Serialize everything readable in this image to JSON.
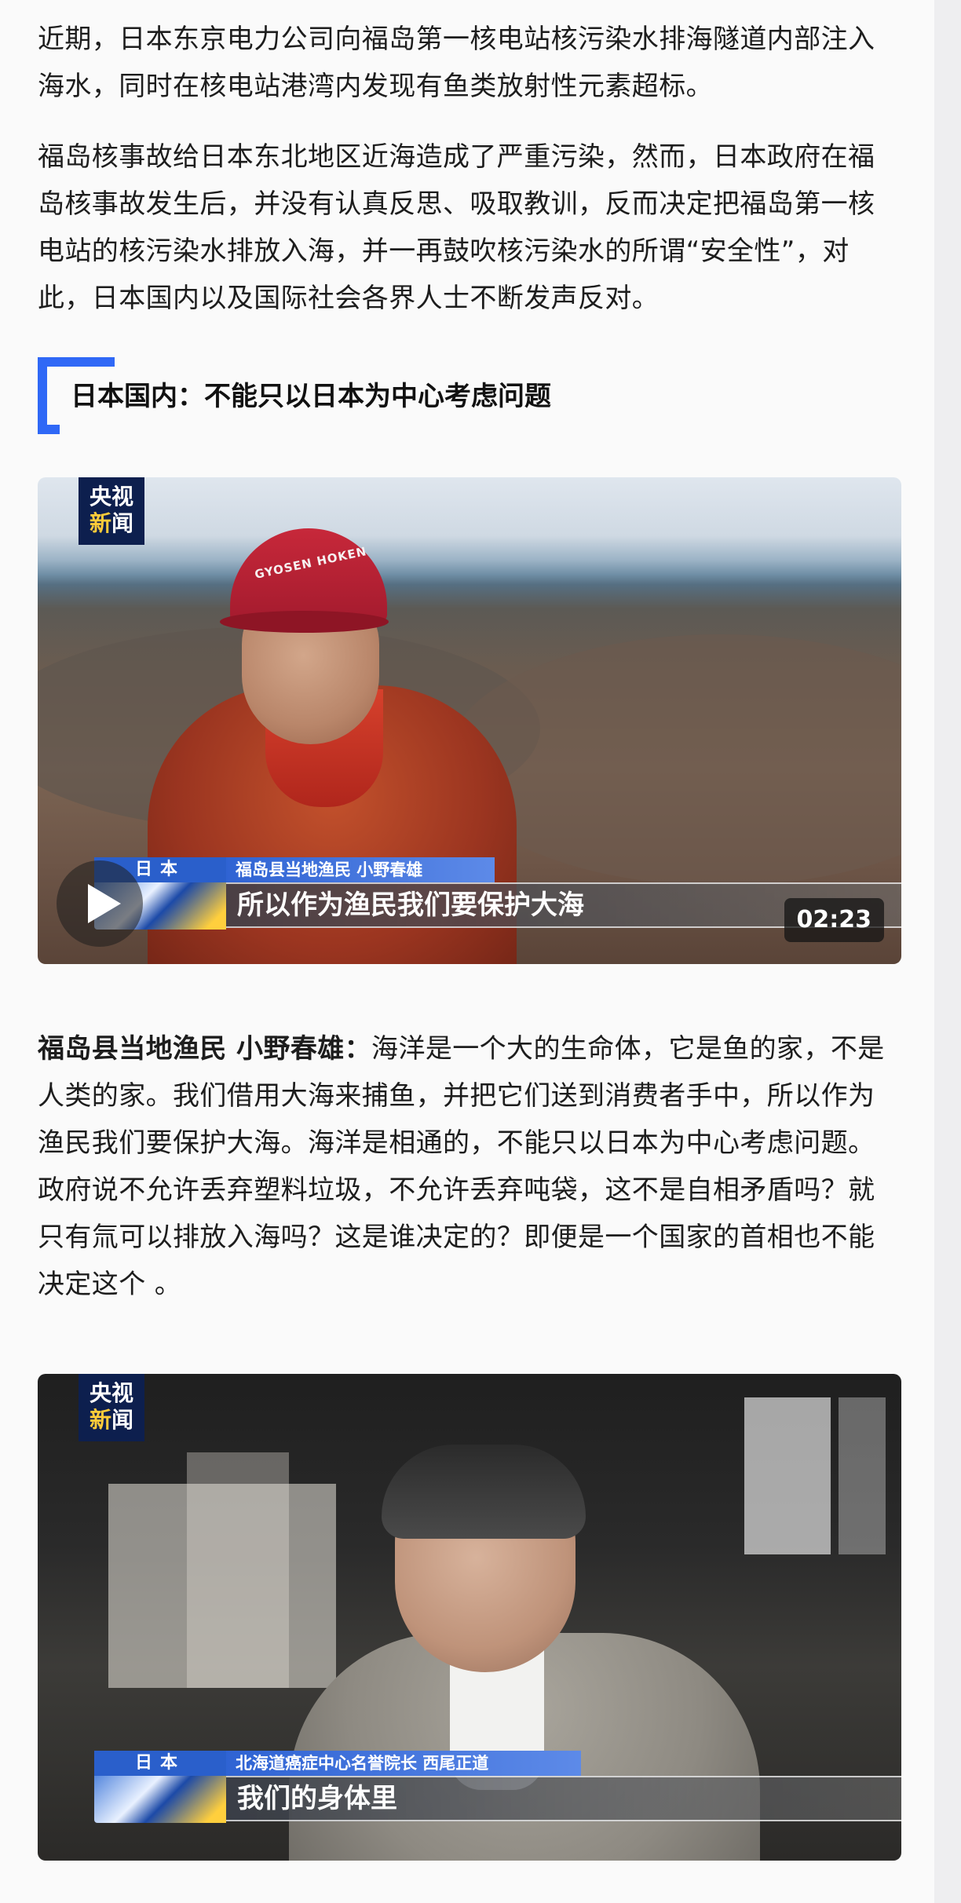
{
  "article": {
    "paragraph1": "近期，日本东京电力公司向福岛第一核电站核污染水排海隧道内部注入海水，同时在核电站港湾内发现有鱼类放射性元素超标。",
    "paragraph2": "福岛核事故给日本东北地区近海造成了严重污染，然而，日本政府在福岛核事故发生后，并没有认真反思、吸取教训，反而决定把福岛第一核电站的核污染水排放入海，并一再鼓吹核污染水的所谓“安全性”，对此，日本国内以及国际社会各界人士不断发声反对。",
    "section_heading": "日本国内：不能只以日本为中心考虑问题",
    "quote1_speaker": "福岛县当地渔民 小野春雄：",
    "quote1_text": "海洋是一个大的生命体，它是鱼的家，不是人类的家。我们借用大海来捕鱼，并把它们送到消费者手中，所以作为渔民我们要保护大海。海洋是相通的，不能只以日本为中心考虑问题。政府说不允许丢弃塑料垃圾，不允许丢弃吨袋，这不是自相矛盾吗？就只有氚可以排放入海吗？这是谁决定的？即便是一个国家的首相也不能决定这个 。"
  },
  "video1": {
    "logo_line1": "央视",
    "logo_line2a": "新",
    "logo_line2b": "闻",
    "cap_text": "GYOSEN HOKEN",
    "country": "日本",
    "name_tag": "福岛县当地渔民 小野春雄",
    "caption": "所以作为渔民我们要保护大海",
    "duration": "02:23"
  },
  "video2": {
    "logo_line1": "央视",
    "logo_line2a": "新",
    "logo_line2b": "闻",
    "country": "日本",
    "name_tag": "北海道癌症中心名誉院长 西尾正道",
    "caption": "我们的身体里"
  },
  "colors": {
    "accent": "#2f68f6",
    "logo_bg": "#0d1f4e",
    "lower_third_blue": "#2a5fcb"
  }
}
